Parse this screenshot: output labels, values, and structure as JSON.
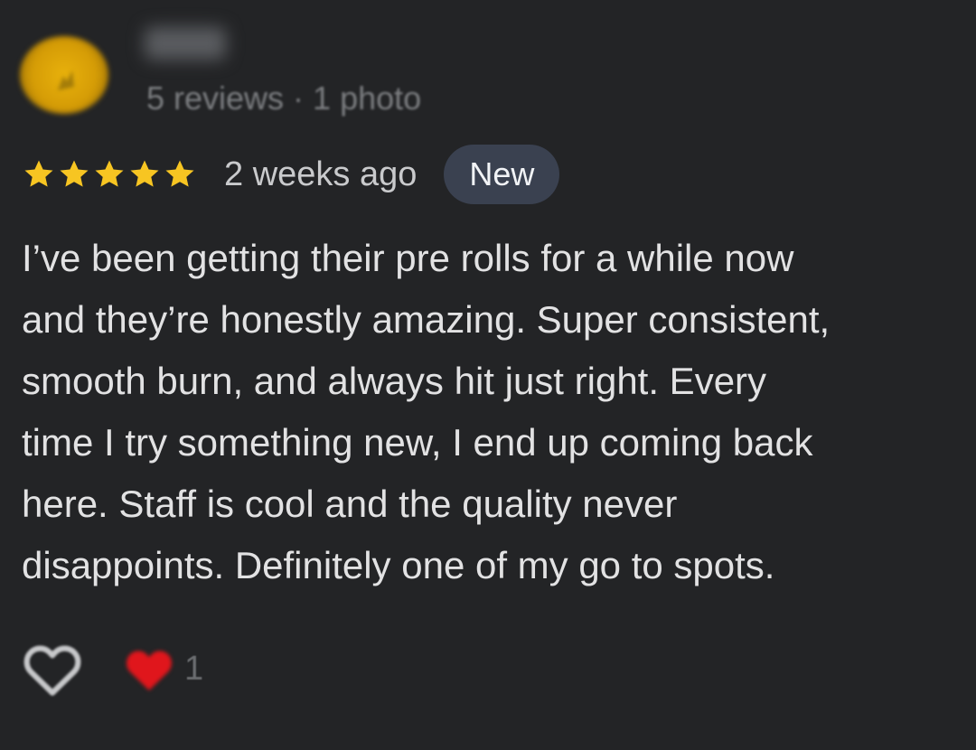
{
  "reviewer": {
    "name": "",
    "meta": "5 reviews · 1 photo"
  },
  "review": {
    "rating": 5,
    "rating_max": 5,
    "time_ago": "2 weeks ago",
    "badge": "New",
    "text": "I’ve been getting their pre rolls for a while now\nand they’re honestly amazing. Super consistent,\nsmooth burn, and always hit just right. Every\ntime I try something new, I end up coming back\nhere. Staff is cool and the quality never\ndisappoints. Definitely one of my go to spots."
  },
  "reactions": {
    "like_icon": "heart-outline-icon",
    "reaction_icon": "red-heart-icon",
    "count": "1"
  },
  "colors": {
    "background": "#232426",
    "star": "#f7c522",
    "badge_bg": "#3a4150",
    "heart": "#e0161c"
  }
}
